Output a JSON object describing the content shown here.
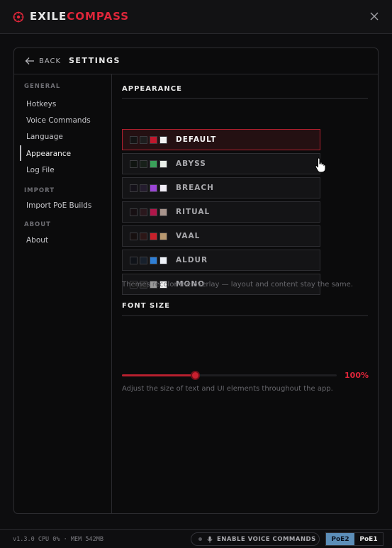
{
  "app": {
    "brand_part1": "EXILE",
    "brand_part2": "COMPASS"
  },
  "header": {
    "back_label": "BACK",
    "title": "SETTINGS"
  },
  "sidebar": {
    "groups": [
      {
        "label": "GENERAL",
        "items": [
          "Hotkeys",
          "Voice Commands",
          "Language",
          "Appearance",
          "Log File"
        ]
      },
      {
        "label": "IMPORT",
        "items": [
          "Import PoE Builds"
        ]
      },
      {
        "label": "ABOUT",
        "items": [
          "About"
        ]
      }
    ],
    "active_item": "Appearance"
  },
  "appearance": {
    "section_title": "APPEARANCE",
    "themes": [
      {
        "label": "DEFAULT",
        "selected": true,
        "swatches": [
          "#141414",
          "#1e1e1e",
          "#c0172c",
          "#f2f2f2"
        ]
      },
      {
        "label": "ABYSS",
        "selected": false,
        "swatches": [
          "#0f1410",
          "#172019",
          "#3aa15a",
          "#e9efe9"
        ]
      },
      {
        "label": "BREACH",
        "selected": false,
        "swatches": [
          "#15121a",
          "#241c2e",
          "#9b45d6",
          "#f0ecf5"
        ]
      },
      {
        "label": "RITUAL",
        "selected": false,
        "swatches": [
          "#160f12",
          "#2a171c",
          "#b0164a",
          "#a8948c"
        ]
      },
      {
        "label": "VAAL",
        "selected": false,
        "swatches": [
          "#160f0f",
          "#2c1616",
          "#c8202a",
          "#b89870"
        ]
      },
      {
        "label": "ALDUR",
        "selected": false,
        "swatches": [
          "#0f1218",
          "#17202c",
          "#2f7fd6",
          "#eef2f8"
        ]
      },
      {
        "label": "MONO",
        "selected": false,
        "swatches": [
          "#121212",
          "#202020",
          "#9a9a9a",
          "#f4f4f4"
        ]
      }
    ],
    "helper": "Themes recolor the overlay — layout and content stay the same."
  },
  "font_size": {
    "section_title": "FONT SIZE",
    "value_label": "100%",
    "slider_fraction": 0.34,
    "helper": "Adjust the size of text and UI elements throughout the app."
  },
  "status": {
    "info": "v1.3.0  CPU 0% · MEM 542MB",
    "voice_button": "ENABLE VOICE COMMANDS",
    "versions": [
      "PoE2",
      "PoE1"
    ],
    "active_version": "PoE2"
  },
  "colors": {
    "accent": "#e0263a",
    "version_active": "#5c8eb8"
  }
}
